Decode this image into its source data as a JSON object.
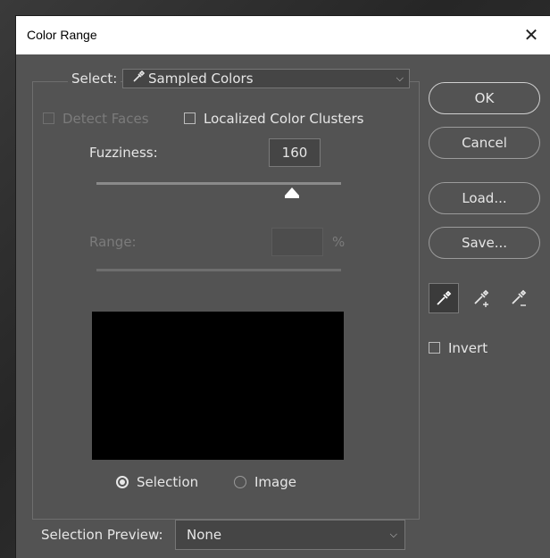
{
  "dialog": {
    "title": "Color Range"
  },
  "select": {
    "label": "Select:",
    "value": "Sampled Colors"
  },
  "options": {
    "detect_faces": "Detect Faces",
    "localized_clusters": "Localized Color Clusters"
  },
  "fuzziness": {
    "label": "Fuzziness:",
    "value": "160",
    "level_fraction": 0.8
  },
  "range": {
    "label": "Range:",
    "value": "",
    "unit": "%"
  },
  "preview_mode": {
    "selection": "Selection",
    "image": "Image",
    "selected": "selection"
  },
  "buttons": {
    "ok": "OK",
    "cancel": "Cancel",
    "load": "Load...",
    "save": "Save..."
  },
  "tools": [
    "eyedropper-icon",
    "eyedropper-plus-icon",
    "eyedropper-minus-icon"
  ],
  "invert": {
    "label": "Invert"
  },
  "selection_preview": {
    "label": "Selection Preview:",
    "value": "None"
  },
  "colors": {
    "dialog_bg": "#535353",
    "field_bg": "#454545",
    "preview_bg": "#000000"
  }
}
